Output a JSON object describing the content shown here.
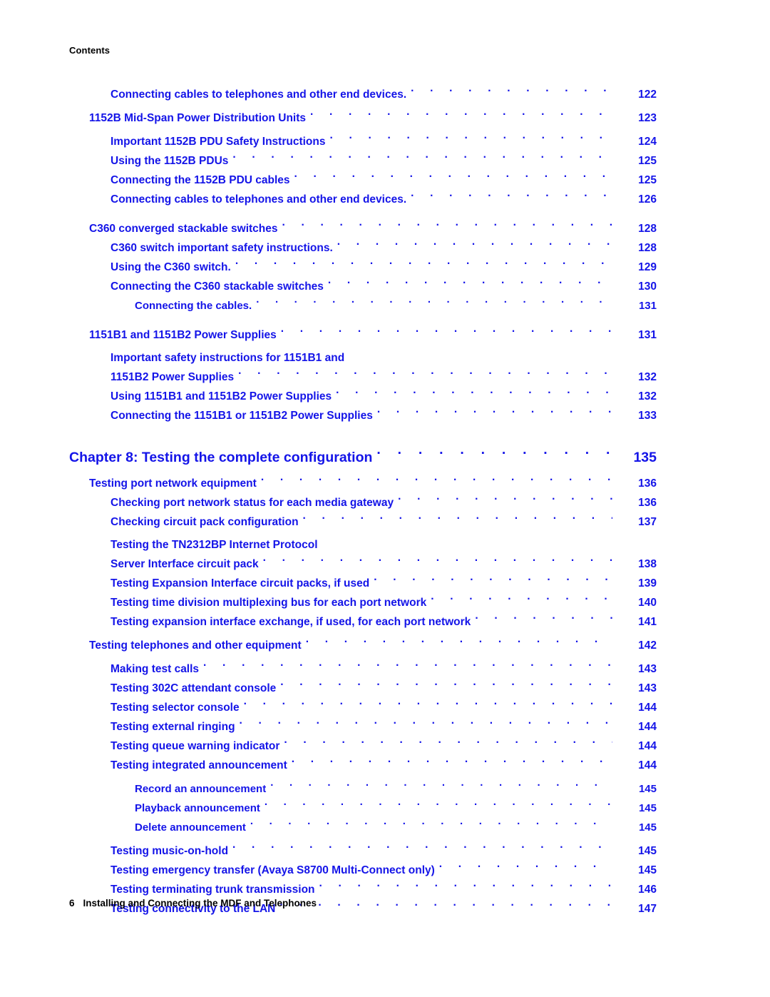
{
  "header": {
    "running_head": "Contents"
  },
  "colors": {
    "link_blue": "#1414E8",
    "text_black": "#000000",
    "page_background": "#FFFFFF"
  },
  "toc": {
    "entries": [
      {
        "title": "Connecting cables to telephones and other end devices.",
        "page": "122",
        "level": 2
      },
      {
        "title": "1152B Mid-Span Power Distribution Units",
        "page": "123",
        "level": 1
      },
      {
        "title": "Important 1152B PDU Safety Instructions",
        "page": "124",
        "level": 2
      },
      {
        "title": "Using the 1152B PDUs",
        "page": "125",
        "level": 2
      },
      {
        "title": "Connecting the 1152B PDU cables",
        "page": "125",
        "level": 2
      },
      {
        "title": "Connecting cables to telephones and other end devices.",
        "page": "126",
        "level": 2
      },
      {
        "title": "C360 converged stackable switches",
        "page": "128",
        "level": 1
      },
      {
        "title": "C360 switch important safety instructions.",
        "page": "128",
        "level": 2
      },
      {
        "title": "Using the C360 switch.",
        "page": "129",
        "level": 2
      },
      {
        "title": "Connecting the C360 stackable switches",
        "page": "130",
        "level": 2
      },
      {
        "title": "Connecting the cables.",
        "page": "131",
        "level": 3
      },
      {
        "title": "1151B1 and 1151B2 Power Supplies",
        "page": "131",
        "level": 1
      },
      {
        "title": "Important safety instructions for 1151B1 and",
        "page": "",
        "level": 2
      },
      {
        "title": "1151B2 Power Supplies",
        "page": "132",
        "level": 2
      },
      {
        "title": "Using 1151B1 and 1151B2 Power Supplies",
        "page": "132",
        "level": 2
      },
      {
        "title": "Connecting the 1151B1 or 1151B2 Power Supplies",
        "page": "133",
        "level": 2
      }
    ],
    "chapter": {
      "title": "Chapter 8: Testing the complete configuration",
      "page": "135"
    },
    "chapter_entries": [
      {
        "title": "Testing port network equipment",
        "page": "136",
        "level": 1
      },
      {
        "title": "Checking port network status for each media gateway",
        "page": "136",
        "level": 2
      },
      {
        "title": "Checking circuit pack configuration",
        "page": "137",
        "level": 2
      },
      {
        "title": "Testing the TN2312BP Internet Protocol",
        "page": "",
        "level": 2
      },
      {
        "title": "Server Interface circuit pack",
        "page": "138",
        "level": 2
      },
      {
        "title": "Testing Expansion Interface circuit packs, if used",
        "page": "139",
        "level": 2
      },
      {
        "title": "Testing time division multiplexing bus for each port network",
        "page": "140",
        "level": 2
      },
      {
        "title": "Testing expansion interface exchange, if used, for each port network",
        "page": "141",
        "level": 2
      },
      {
        "title": "Testing telephones and other equipment",
        "page": "142",
        "level": 1
      },
      {
        "title": "Making test calls",
        "page": "143",
        "level": 2
      },
      {
        "title": "Testing 302C attendant console",
        "page": "143",
        "level": 2
      },
      {
        "title": "Testing selector console",
        "page": "144",
        "level": 2
      },
      {
        "title": "Testing external ringing",
        "page": "144",
        "level": 2
      },
      {
        "title": "Testing queue warning indicator",
        "page": "144",
        "level": 2
      },
      {
        "title": "Testing integrated announcement",
        "page": "144",
        "level": 2
      },
      {
        "title": "Record an announcement",
        "page": "145",
        "level": 3
      },
      {
        "title": "Playback announcement",
        "page": "145",
        "level": 3
      },
      {
        "title": "Delete announcement",
        "page": "145",
        "level": 3
      },
      {
        "title": "Testing music-on-hold",
        "page": "145",
        "level": 2
      },
      {
        "title": "Testing emergency transfer (Avaya S8700 Multi-Connect only)",
        "page": "145",
        "level": 2
      },
      {
        "title": "Testing terminating trunk transmission",
        "page": "146",
        "level": 2
      },
      {
        "title": "Testing connectivity to the LAN",
        "page": "147",
        "level": 2
      }
    ]
  },
  "footer": {
    "folio": "6",
    "document_title": "Installing and Connecting the MDF and Telephones"
  }
}
